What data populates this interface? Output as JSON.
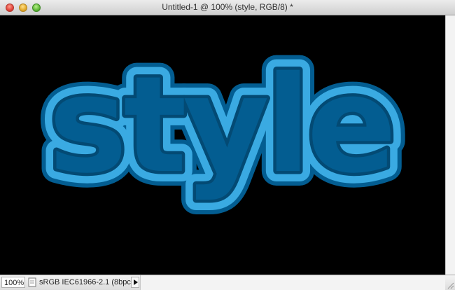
{
  "window": {
    "title": "Untitled-1 @ 100% (style, RGB/8) *"
  },
  "canvas": {
    "text": "style",
    "colors": {
      "background": "#000000",
      "fill": "#035d91",
      "inner_stroke": "#034a74",
      "outer_stroke": "#3aaae2",
      "outline": "#035d91"
    }
  },
  "statusbar": {
    "zoom": "100%",
    "doc_info": "sRGB IEC61966-2.1 (8bpc)"
  },
  "icons": {
    "close": "close-traffic-light",
    "minimize": "minimize-traffic-light",
    "zoom": "zoom-traffic-light",
    "doc_info": "document-info-icon",
    "menu": "triangle-right-icon"
  }
}
